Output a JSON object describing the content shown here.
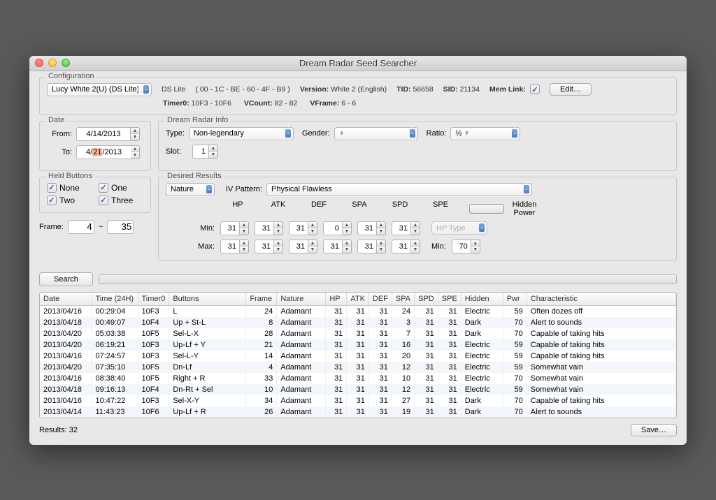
{
  "title": "Dream Radar Seed Searcher",
  "config": {
    "legend": "Configuration",
    "profile": "Lucy White 2(U) (DS Lite)",
    "system": "DS Lite",
    "mac": "( 00 - 1C - BE - 60 - 4F - B9 )",
    "version_lbl": "Version:",
    "version": "White 2 (English)",
    "tid_lbl": "TID:",
    "tid": "56658",
    "sid_lbl": "SID:",
    "sid": "21134",
    "memlink_lbl": "Mem Link:",
    "edit": "Edit…",
    "timer0_lbl": "Timer0:",
    "timer0": "10F3 - 10F6",
    "vcount_lbl": "VCount:",
    "vcount": "82 - 82",
    "vframe_lbl": "VFrame:",
    "vframe": "6 - 6"
  },
  "date": {
    "legend": "Date",
    "from_lbl": "From:",
    "from": "4/14/2013",
    "to_lbl": "To:",
    "to_pre": "4/",
    "to_hl": "21",
    "to_post": "/2013"
  },
  "dri": {
    "legend": "Dream Radar Info",
    "type_lbl": "Type:",
    "type": "Non-legendary",
    "gender_lbl": "Gender:",
    "gender": "♀",
    "ratio_lbl": "Ratio:",
    "ratio": "½ ♀",
    "slot_lbl": "Slot:",
    "slot": "1"
  },
  "held": {
    "legend": "Held Buttons",
    "none": "None",
    "one": "One",
    "two": "Two",
    "three": "Three"
  },
  "frame": {
    "lbl": "Frame:",
    "min": "4",
    "sep": "~",
    "max": "35"
  },
  "desired": {
    "legend": "Desired Results",
    "nature": "Nature",
    "ivpat_lbl": "IV Pattern:",
    "ivpat": "Physical Flawless",
    "hp": "HP",
    "atk": "ATK",
    "def": "DEF",
    "spa": "SPA",
    "spd": "SPD",
    "spe": "SPE",
    "min_lbl": "Min:",
    "max_lbl": "Max:",
    "min": {
      "hp": "31",
      "atk": "31",
      "def": "31",
      "spa": "0",
      "spd": "31",
      "spe": "31"
    },
    "max": {
      "hp": "31",
      "atk": "31",
      "def": "31",
      "spa": "31",
      "spd": "31",
      "spe": "31"
    },
    "hidden_lbl": "Hidden Power",
    "hptype": "HP Type",
    "hpmin_lbl": "Min:",
    "hpmin": "70"
  },
  "search": "Search",
  "columns": {
    "date": "Date",
    "time": "Time (24H)",
    "timer0": "Timer0",
    "buttons": "Buttons",
    "frame": "Frame",
    "nature": "Nature",
    "hp": "HP",
    "atk": "ATK",
    "def": "DEF",
    "spa": "SPA",
    "spd": "SPD",
    "spe": "SPE",
    "hidden": "Hidden",
    "pwr": "Pwr",
    "char": "Characteristic"
  },
  "rows": [
    {
      "date": "2013/04/16",
      "time": "00:29:04",
      "t0": "10F3",
      "btn": "L",
      "frame": 24,
      "nat": "Adamant",
      "hp": 31,
      "atk": 31,
      "def": 31,
      "spa": 24,
      "spd": 31,
      "spe": 31,
      "hid": "Electric",
      "pwr": 59,
      "ch": "Often dozes off"
    },
    {
      "date": "2013/04/18",
      "time": "00:49:07",
      "t0": "10F4",
      "btn": "Up + St-L",
      "frame": 8,
      "nat": "Adamant",
      "hp": 31,
      "atk": 31,
      "def": 31,
      "spa": 3,
      "spd": 31,
      "spe": 31,
      "hid": "Dark",
      "pwr": 70,
      "ch": "Alert to sounds"
    },
    {
      "date": "2013/04/20",
      "time": "05:03:38",
      "t0": "10F5",
      "btn": "Sel-L-X",
      "frame": 28,
      "nat": "Adamant",
      "hp": 31,
      "atk": 31,
      "def": 31,
      "spa": 7,
      "spd": 31,
      "spe": 31,
      "hid": "Dark",
      "pwr": 70,
      "ch": "Capable of taking hits"
    },
    {
      "date": "2013/04/20",
      "time": "06:19:21",
      "t0": "10F3",
      "btn": "Up-Lf + Y",
      "frame": 21,
      "nat": "Adamant",
      "hp": 31,
      "atk": 31,
      "def": 31,
      "spa": 16,
      "spd": 31,
      "spe": 31,
      "hid": "Electric",
      "pwr": 59,
      "ch": "Capable of taking hits"
    },
    {
      "date": "2013/04/16",
      "time": "07:24:57",
      "t0": "10F3",
      "btn": "Sel-L-Y",
      "frame": 14,
      "nat": "Adamant",
      "hp": 31,
      "atk": 31,
      "def": 31,
      "spa": 20,
      "spd": 31,
      "spe": 31,
      "hid": "Electric",
      "pwr": 59,
      "ch": "Capable of taking hits"
    },
    {
      "date": "2013/04/20",
      "time": "07:35:10",
      "t0": "10F5",
      "btn": "Dn-Lf",
      "frame": 4,
      "nat": "Adamant",
      "hp": 31,
      "atk": 31,
      "def": 31,
      "spa": 12,
      "spd": 31,
      "spe": 31,
      "hid": "Electric",
      "pwr": 59,
      "ch": "Somewhat vain"
    },
    {
      "date": "2013/04/16",
      "time": "08:38:40",
      "t0": "10F5",
      "btn": "Right + R",
      "frame": 33,
      "nat": "Adamant",
      "hp": 31,
      "atk": 31,
      "def": 31,
      "spa": 10,
      "spd": 31,
      "spe": 31,
      "hid": "Electric",
      "pwr": 70,
      "ch": "Somewhat vain"
    },
    {
      "date": "2013/04/18",
      "time": "09:16:13",
      "t0": "10F4",
      "btn": "Dn-Rt + Sel",
      "frame": 10,
      "nat": "Adamant",
      "hp": 31,
      "atk": 31,
      "def": 31,
      "spa": 12,
      "spd": 31,
      "spe": 31,
      "hid": "Electric",
      "pwr": 59,
      "ch": "Somewhat vain"
    },
    {
      "date": "2013/04/16",
      "time": "10:47:22",
      "t0": "10F3",
      "btn": "Sel-X-Y",
      "frame": 34,
      "nat": "Adamant",
      "hp": 31,
      "atk": 31,
      "def": 31,
      "spa": 27,
      "spd": 31,
      "spe": 31,
      "hid": "Dark",
      "pwr": 70,
      "ch": "Capable of taking hits"
    },
    {
      "date": "2013/04/14",
      "time": "11:43:23",
      "t0": "10F6",
      "btn": "Up-Lf + R",
      "frame": 26,
      "nat": "Adamant",
      "hp": 31,
      "atk": 31,
      "def": 31,
      "spa": 19,
      "spd": 31,
      "spe": 31,
      "hid": "Dark",
      "pwr": 70,
      "ch": "Alert to sounds"
    }
  ],
  "results_lbl": "Results: 32",
  "save": "Save…"
}
